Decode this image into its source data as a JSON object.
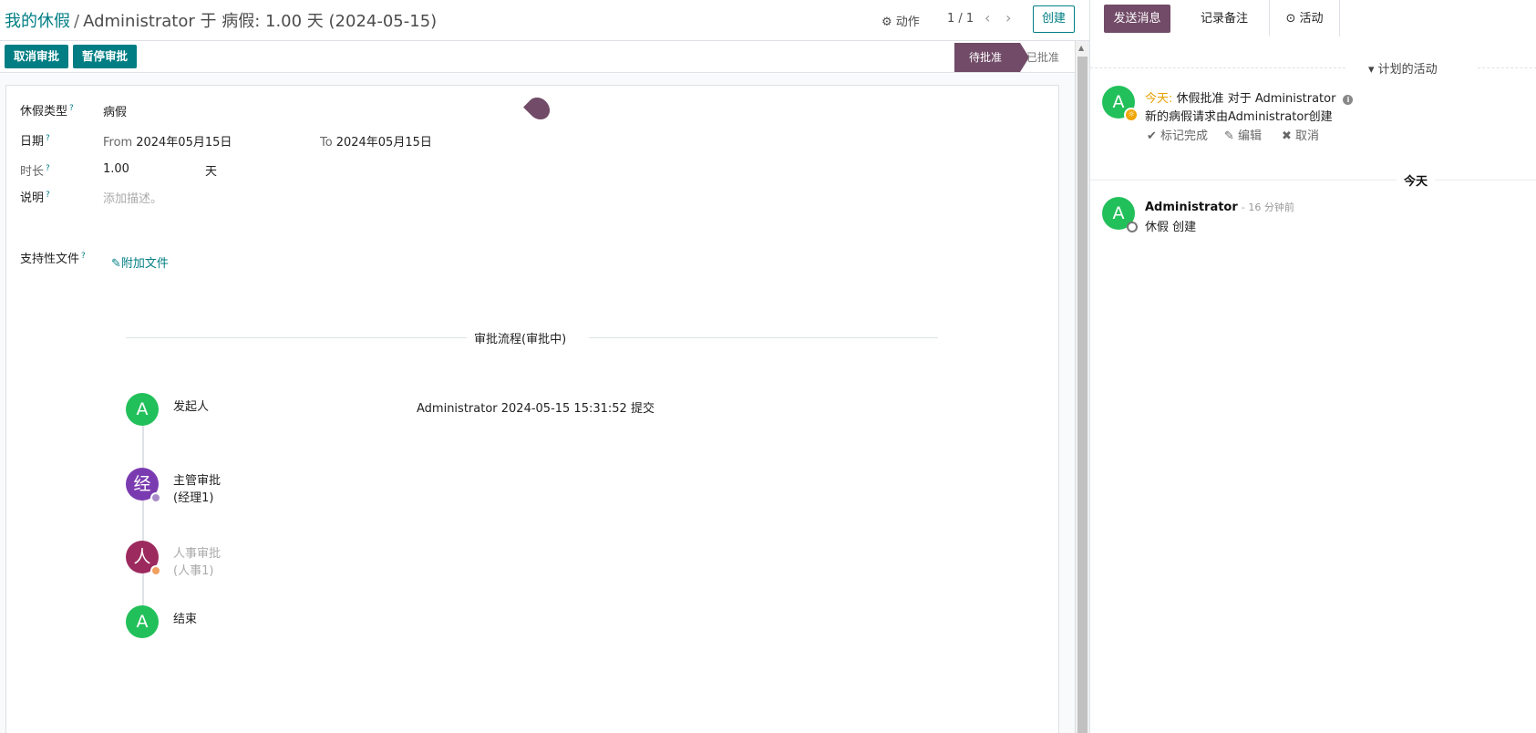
{
  "breadcrumb": {
    "parent": "我的休假",
    "separator": "/",
    "current": "Administrator 于 病假: 1.00 天 (2024-05-15)"
  },
  "toolbar": {
    "action_label": "动作",
    "pager_value": "1 / 1",
    "prev": "‹",
    "next": "›",
    "create_label": "创建"
  },
  "statusbar": {
    "buttons": [
      "取消审批",
      "暂停审批"
    ],
    "stages": {
      "active": "待批准",
      "next": "已批准"
    }
  },
  "form": {
    "leave_type": {
      "label": "休假类型",
      "help": "?",
      "value": "病假"
    },
    "date": {
      "label": "日期",
      "help": "?",
      "from_prefix": "From",
      "from": "2024年05月15日",
      "to_prefix": "To",
      "to": "2024年05月15日"
    },
    "duration": {
      "label": "时长",
      "help": "?",
      "value": "1.00",
      "unit": "天"
    },
    "description": {
      "label": "说明",
      "help": "?",
      "placeholder": "添加描述。"
    },
    "attachments": {
      "label": "支持性文件",
      "help": "?",
      "button": "附加文件"
    }
  },
  "workflow": {
    "title": "审批流程(审批中)",
    "steps": [
      {
        "avatar": "A",
        "color": "#22c05a",
        "label": "发起人",
        "sub": "",
        "done": true
      },
      {
        "avatar": "经",
        "color": "#7b3bb0",
        "label": "主管审批",
        "sub": "(经理1)",
        "done": true
      },
      {
        "avatar": "人",
        "color": "#9c2a5e",
        "label": "人事审批",
        "sub": "(人事1)",
        "done": false
      },
      {
        "avatar": "A",
        "color": "#22c05a",
        "label": "结束",
        "sub": "",
        "done": true
      }
    ],
    "info": "Administrator 2024-05-15 15:31:52 提交"
  },
  "chatter": {
    "send_message": "发送消息",
    "log_note": "记录备注",
    "activity": "活动",
    "planned_title": "计划的活动",
    "activity_item": {
      "avatar": "A",
      "today": "今天:",
      "summary": "休假批准",
      "for_text": "对于 Administrator",
      "note": "新的病假请求由Administrator创建",
      "mark_done": "标记完成",
      "edit": "编辑",
      "cancel": "取消"
    },
    "day_separator": "今天",
    "message": {
      "avatar": "A",
      "author": "Administrator",
      "ago": "- 16 分钟前",
      "body": "休假 创建"
    }
  }
}
